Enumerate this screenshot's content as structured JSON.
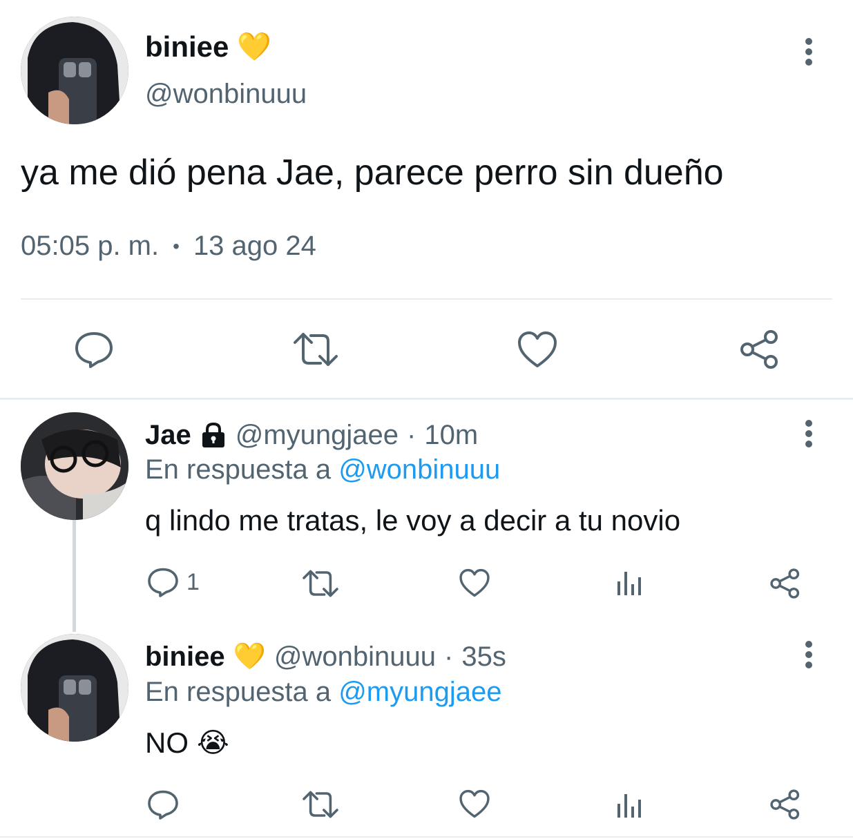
{
  "main_tweet": {
    "display_name": "biniee",
    "name_emoji": "💛",
    "handle": "@wonbinuuu",
    "text": "ya me dió pena Jae, parece perro sin dueño",
    "time": "05:05 p. m.",
    "separator": "•",
    "date": "13 ago 24",
    "actions": [
      "reply-icon",
      "retweet-icon",
      "like-icon",
      "share-icon"
    ]
  },
  "replies": [
    {
      "display_name": "Jae",
      "lock_icon": "lock-icon",
      "handle": "@myungjaee",
      "dot": "·",
      "time": "10m",
      "reply_to_prefix": "En respuesta a",
      "reply_to_handle": "@wonbinuuu",
      "text": "q lindo me tratas, le voy a decir a tu novio",
      "reply_count": "1",
      "actions": [
        "reply-icon",
        "retweet-icon",
        "like-icon",
        "analytics-icon",
        "share-icon"
      ]
    },
    {
      "display_name": "biniee",
      "name_emoji": "💛",
      "handle": "@wonbinuuu",
      "dot": "·",
      "time": "35s",
      "reply_to_prefix": "En respuesta a",
      "reply_to_handle": "@myungjaee",
      "text": "NO",
      "text_emoji": "😭",
      "reply_count": "",
      "actions": [
        "reply-icon",
        "retweet-icon",
        "like-icon",
        "analytics-icon",
        "share-icon"
      ]
    }
  ],
  "colors": {
    "text": "#0f1419",
    "muted": "#536471",
    "link": "#1d9bf0",
    "divider": "#e6ecf0",
    "icon": "#536471"
  }
}
